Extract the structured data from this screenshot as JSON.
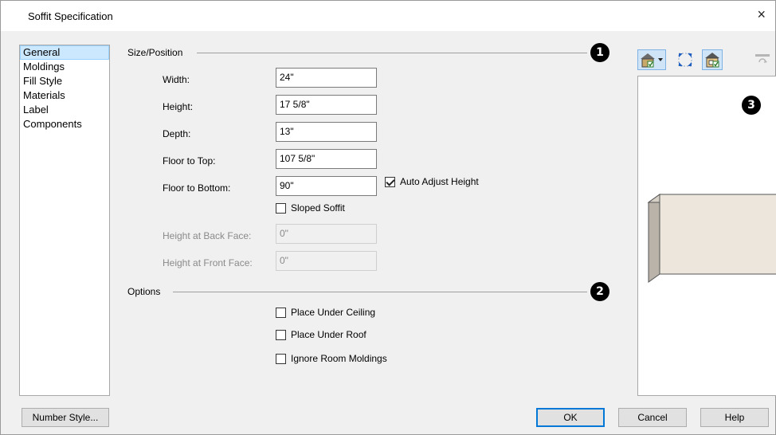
{
  "window": {
    "title": "Soffit Specification",
    "close_glyph": "×"
  },
  "nav": {
    "items": [
      {
        "label": "General",
        "selected": true
      },
      {
        "label": "Moldings",
        "selected": false
      },
      {
        "label": "Fill Style",
        "selected": false
      },
      {
        "label": "Materials",
        "selected": false
      },
      {
        "label": "Label",
        "selected": false
      },
      {
        "label": "Components",
        "selected": false
      }
    ]
  },
  "size_position": {
    "heading": "Size/Position",
    "marker": "1",
    "width_label": "Width:",
    "width_value": "24\"",
    "height_label": "Height:",
    "height_value": "17 5/8\"",
    "depth_label": "Depth:",
    "depth_value": "13\"",
    "floor_top_label": "Floor to Top:",
    "floor_top_value": "107 5/8\"",
    "floor_bottom_label": "Floor to Bottom:",
    "floor_bottom_value": "90\"",
    "auto_adjust_label": "Auto Adjust Height",
    "auto_adjust_checked": true,
    "sloped_label": "Sloped Soffit",
    "sloped_checked": false,
    "back_face_label": "Height at Back Face:",
    "back_face_value": "0\"",
    "front_face_label": "Height at Front Face:",
    "front_face_value": "0\""
  },
  "options": {
    "heading": "Options",
    "marker": "2",
    "under_ceiling_label": "Place Under Ceiling",
    "under_roof_label": "Place Under Roof",
    "ignore_moldings_label": "Ignore Room Moldings"
  },
  "preview": {
    "marker": "3",
    "object_color": "#ece6dc"
  },
  "toolbar": {
    "icons": [
      "view-mode-icon",
      "fit-view-icon",
      "rendered-view-icon",
      "rotate-view-icon"
    ]
  },
  "buttons": {
    "number_style": "Number Style...",
    "ok": "OK",
    "cancel": "Cancel",
    "help": "Help"
  },
  "colors": {
    "selection": "#cce8ff",
    "pressed": "#d0e4f7",
    "accent": "#0078d7"
  }
}
